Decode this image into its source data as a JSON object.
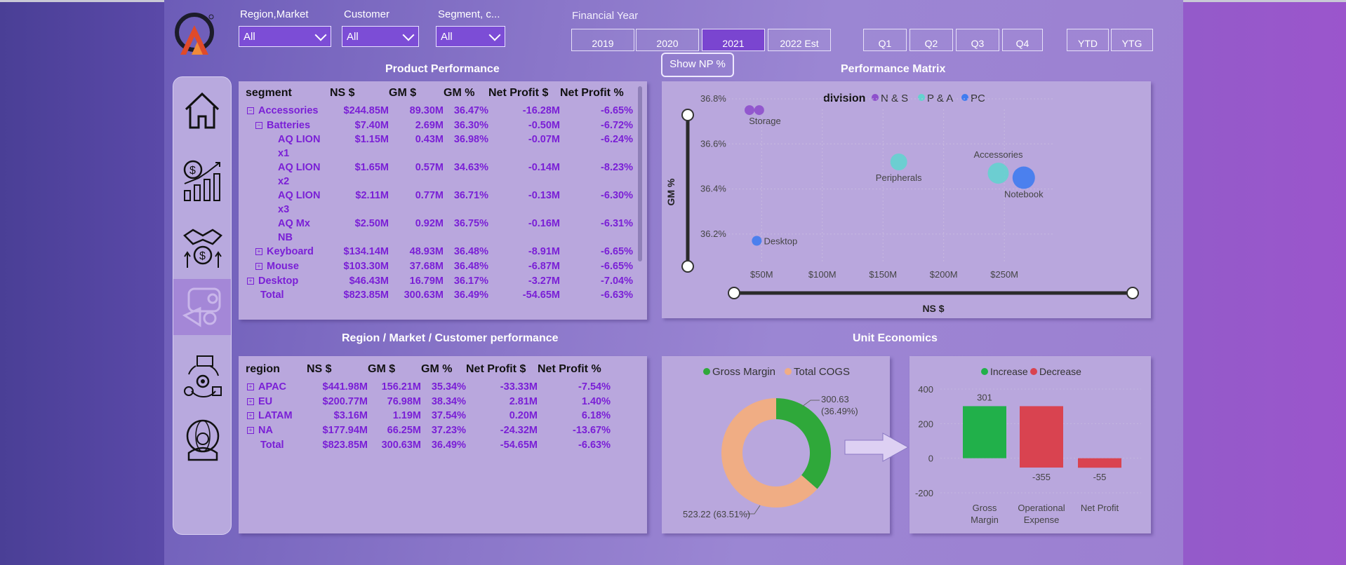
{
  "filters": [
    {
      "label": "Region,Market",
      "value": "All"
    },
    {
      "label": "Customer",
      "value": "All"
    },
    {
      "label": "Segment, c...",
      "value": "All"
    }
  ],
  "financial_year": {
    "label": "Financial Year",
    "years": [
      "2019",
      "2020",
      "2021",
      "2022 Est"
    ],
    "selected": "2021",
    "quarters": [
      "Q1",
      "Q2",
      "Q3",
      "Q4"
    ],
    "periods": [
      "YTD",
      "YTG"
    ]
  },
  "toggle_label": "Show NP %",
  "nav": {
    "items": [
      "home-icon",
      "revenue-growth-icon",
      "finance-icon",
      "marketing-icon",
      "supply-chain-icon",
      "executive-icon"
    ],
    "selected_index": 3
  },
  "product_performance": {
    "title": "Product Performance",
    "columns": [
      "segment",
      "NS $",
      "GM $",
      "GM %",
      "Net Profit $",
      "Net Profit %"
    ],
    "rows": [
      {
        "level": 0,
        "expand": "⊟",
        "name": "Accessories",
        "ns": "$244.85M",
        "gm": "89.30M",
        "gmp": "36.47%",
        "np": "-16.28M",
        "npp": "-6.65%"
      },
      {
        "level": 1,
        "expand": "⊟",
        "name": "Batteries",
        "ns": "$7.40M",
        "gm": "2.69M",
        "gmp": "36.30%",
        "np": "-0.50M",
        "npp": "-6.72%"
      },
      {
        "level": 2,
        "expand": "",
        "name": "AQ LION",
        "name2": "x1",
        "ns": "$1.15M",
        "gm": "0.43M",
        "gmp": "36.98%",
        "np": "-0.07M",
        "npp": "-6.24%"
      },
      {
        "level": 2,
        "expand": "",
        "name": "AQ LION",
        "name2": "x2",
        "ns": "$1.65M",
        "gm": "0.57M",
        "gmp": "34.63%",
        "np": "-0.14M",
        "npp": "-8.23%"
      },
      {
        "level": 2,
        "expand": "",
        "name": "AQ LION",
        "name2": "x3",
        "ns": "$2.11M",
        "gm": "0.77M",
        "gmp": "36.71%",
        "np": "-0.13M",
        "npp": "-6.30%"
      },
      {
        "level": 2,
        "expand": "",
        "name": "AQ Mx",
        "name2": "NB",
        "ns": "$2.50M",
        "gm": "0.92M",
        "gmp": "36.75%",
        "np": "-0.16M",
        "npp": "-6.31%"
      },
      {
        "level": 1,
        "expand": "⊞",
        "name": "Keyboard",
        "ns": "$134.14M",
        "gm": "48.93M",
        "gmp": "36.48%",
        "np": "-8.91M",
        "npp": "-6.65%"
      },
      {
        "level": 1,
        "expand": "⊞",
        "name": "Mouse",
        "ns": "$103.30M",
        "gm": "37.68M",
        "gmp": "36.48%",
        "np": "-6.87M",
        "npp": "-6.65%"
      },
      {
        "level": 0,
        "expand": "⊞",
        "name": "Desktop",
        "ns": "$46.43M",
        "gm": "16.79M",
        "gmp": "36.17%",
        "np": "-3.27M",
        "npp": "-7.04%"
      }
    ],
    "total": {
      "name": "Total",
      "ns": "$823.85M",
      "gm": "300.63M",
      "gmp": "36.49%",
      "np": "-54.65M",
      "npp": "-6.63%"
    }
  },
  "region_performance": {
    "title": "Region / Market / Customer performance",
    "columns": [
      "region",
      "NS $",
      "GM $",
      "GM %",
      "Net Profit $",
      "Net Profit %"
    ],
    "rows": [
      {
        "expand": "⊞",
        "name": "APAC",
        "ns": "$441.98M",
        "gm": "156.21M",
        "gmp": "35.34%",
        "np": "-33.33M",
        "npp": "-7.54%"
      },
      {
        "expand": "⊞",
        "name": "EU",
        "ns": "$200.77M",
        "gm": "76.98M",
        "gmp": "38.34%",
        "np": "2.81M",
        "npp": "1.40%"
      },
      {
        "expand": "⊞",
        "name": "LATAM",
        "ns": "$3.16M",
        "gm": "1.19M",
        "gmp": "37.54%",
        "np": "0.20M",
        "npp": "6.18%"
      },
      {
        "expand": "⊞",
        "name": "NA",
        "ns": "$177.94M",
        "gm": "66.25M",
        "gmp": "37.23%",
        "np": "-24.32M",
        "npp": "-13.67%"
      }
    ],
    "total": {
      "name": "Total",
      "ns": "$823.85M",
      "gm": "300.63M",
      "gmp": "36.49%",
      "np": "-54.65M",
      "npp": "-6.63%"
    }
  },
  "colors": {
    "n_s": "#8e4fcc",
    "p_a": "#64d3cf",
    "pc": "#3f7cf0",
    "gross_margin": "#2fa83a",
    "total_cogs": "#f0ad84",
    "increase": "#21b04a",
    "decrease": "#d94350"
  },
  "chart_data": [
    {
      "type": "scatter",
      "title": "Performance Matrix",
      "legend_title": "division",
      "series": [
        {
          "name": "N & S",
          "points": [
            {
              "label": "Storage",
              "x": 40,
              "y": 36.75
            },
            {
              "label": "",
              "x": 48,
              "y": 36.75
            }
          ]
        },
        {
          "name": "P & A",
          "points": [
            {
              "label": "Peripherals",
              "x": 163,
              "y": 36.52
            },
            {
              "label": "Accessories",
              "x": 245,
              "y": 36.47
            }
          ]
        },
        {
          "name": "PC",
          "points": [
            {
              "label": "Desktop",
              "x": 46,
              "y": 36.17
            },
            {
              "label": "Notebook",
              "x": 266,
              "y": 36.45
            }
          ]
        }
      ],
      "x_ticks": [
        "$50M",
        "$100M",
        "$150M",
        "$200M",
        "$250M"
      ],
      "y_ticks": [
        "36.2%",
        "36.4%",
        "36.6%",
        "36.8%"
      ],
      "xlabel": "NS $",
      "ylabel": "GM %",
      "xlim": [
        40,
        280
      ],
      "ylim": [
        36.1,
        36.8
      ],
      "legend_position": "top"
    },
    {
      "type": "pie",
      "title": "Unit Economics",
      "slices": [
        {
          "name": "Gross Margin",
          "value": 300.63,
          "label": "300.63",
          "pct_label": "(36.49%)"
        },
        {
          "name": "Total COGS",
          "value": 523.22,
          "label": "523.22 (63.51%)"
        }
      ],
      "legend_position": "top"
    },
    {
      "type": "bar",
      "subtype": "waterfall",
      "legend": [
        "Increase",
        "Decrease"
      ],
      "categories": [
        "Gross Margin",
        "Operational Expense",
        "Net Profit"
      ],
      "values": [
        301,
        -355,
        -55
      ],
      "value_labels": [
        "301",
        "-355",
        "-55"
      ],
      "y_ticks": [
        "400",
        "200",
        "0",
        "-200"
      ],
      "ylim": [
        -250,
        420
      ]
    }
  ]
}
